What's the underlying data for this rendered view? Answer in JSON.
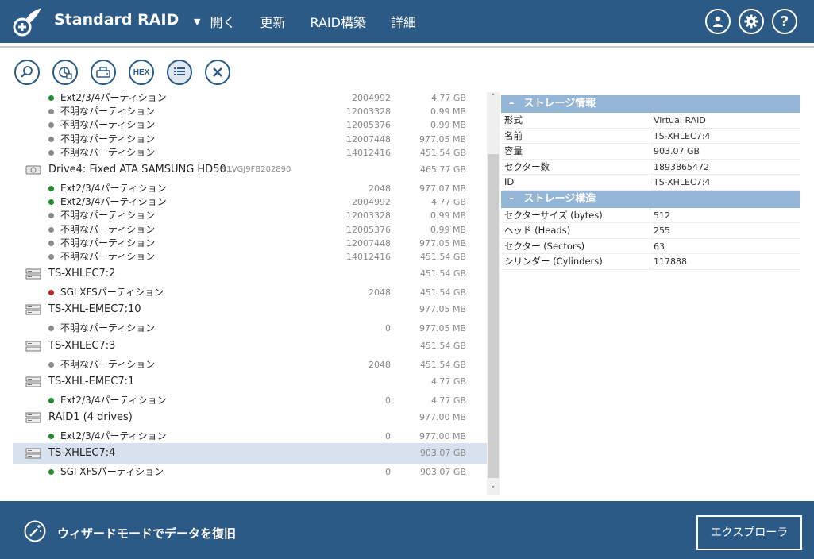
{
  "header": {
    "title": "Standard RAID",
    "menu_arrow": "▼",
    "menu": [
      "開く",
      "更新",
      "RAID構築",
      "詳細"
    ],
    "buttons": [
      {
        "name": "user-button",
        "icon": "user-icon"
      },
      {
        "name": "settings-button",
        "icon": "gear-icon"
      },
      {
        "name": "help-button",
        "icon": "help-icon",
        "glyph": "?"
      }
    ]
  },
  "toolbar": {
    "hex_label": "HEX",
    "icons": [
      "search-icon",
      "chart-icon",
      "drive-scan-icon",
      "hex-icon",
      "list-icon",
      "close-icon"
    ]
  },
  "tree": [
    {
      "kind": "part",
      "status": "green",
      "label": "Ext2/3/4パーティション",
      "offset": "2004992",
      "size": "4.77 GB"
    },
    {
      "kind": "part",
      "status": "gray",
      "label": "不明なパーティション",
      "offset": "12003328",
      "size": "0.99 MB"
    },
    {
      "kind": "part",
      "status": "gray",
      "label": "不明なパーティション",
      "offset": "12005376",
      "size": "0.99 MB"
    },
    {
      "kind": "part",
      "status": "gray",
      "label": "不明なパーティション",
      "offset": "12007448",
      "size": "977.05 MB"
    },
    {
      "kind": "part",
      "status": "gray",
      "label": "不明なパーティション",
      "offset": "14012416",
      "size": "451.54 GB"
    },
    {
      "kind": "dev",
      "icon": "hdd",
      "label": "Drive4: Fixed ATA SAMSUNG HD50...",
      "serial": "S1VGJ9FB202890",
      "size": "465.77 GB"
    },
    {
      "kind": "part",
      "status": "green",
      "label": "Ext2/3/4パーティション",
      "offset": "2048",
      "size": "977.07 MB"
    },
    {
      "kind": "part",
      "status": "green",
      "label": "Ext2/3/4パーティション",
      "offset": "2004992",
      "size": "4.77 GB"
    },
    {
      "kind": "part",
      "status": "gray",
      "label": "不明なパーティション",
      "offset": "12003328",
      "size": "0.99 MB"
    },
    {
      "kind": "part",
      "status": "gray",
      "label": "不明なパーティション",
      "offset": "12005376",
      "size": "0.99 MB"
    },
    {
      "kind": "part",
      "status": "gray",
      "label": "不明なパーティション",
      "offset": "12007448",
      "size": "977.05 MB"
    },
    {
      "kind": "part",
      "status": "gray",
      "label": "不明なパーティション",
      "offset": "14012416",
      "size": "451.54 GB"
    },
    {
      "kind": "dev",
      "icon": "raid",
      "label": "TS-XHLEC7:2",
      "size": "451.54 GB"
    },
    {
      "kind": "part",
      "status": "red",
      "label": "SGI XFSパーティション",
      "offset": "2048",
      "size": "451.54 GB"
    },
    {
      "kind": "dev",
      "icon": "raid",
      "label": "TS-XHL-EMEC7:10",
      "size": "977.05 MB"
    },
    {
      "kind": "part",
      "status": "gray",
      "label": "不明なパーティション",
      "offset": "0",
      "size": "977.05 MB"
    },
    {
      "kind": "dev",
      "icon": "raid",
      "label": "TS-XHLEC7:3",
      "size": "451.54 GB"
    },
    {
      "kind": "part",
      "status": "gray",
      "label": "不明なパーティション",
      "offset": "2048",
      "size": "451.54 GB"
    },
    {
      "kind": "dev",
      "icon": "raid",
      "label": "TS-XHL-EMEC7:1",
      "size": "4.77 GB"
    },
    {
      "kind": "part",
      "status": "green",
      "label": "Ext2/3/4パーティション",
      "offset": "0",
      "size": "4.77 GB"
    },
    {
      "kind": "dev",
      "icon": "raid",
      "label": "RAID1 (4 drives)",
      "size": "977.00 MB"
    },
    {
      "kind": "part",
      "status": "green",
      "label": "Ext2/3/4パーティション",
      "offset": "0",
      "size": "977.00 MB"
    },
    {
      "kind": "dev",
      "icon": "raid",
      "label": "TS-XHLEC7:4",
      "size": "903.07 GB",
      "selected": true
    },
    {
      "kind": "part",
      "status": "green",
      "label": "SGI XFSパーティション",
      "offset": "0",
      "size": "903.07 GB"
    }
  ],
  "scrollbar": {
    "up": "˄",
    "down": "˅"
  },
  "properties": {
    "storage_info": {
      "title": "ストレージ情報",
      "rows": [
        {
          "k": "形式",
          "v": "Virtual RAID"
        },
        {
          "k": "名前",
          "v": "TS-XHLEC7:4"
        },
        {
          "k": "容量",
          "v": "903.07 GB"
        },
        {
          "k": "セクター数",
          "v": "1893865472"
        },
        {
          "k": "ID",
          "v": "TS-XHLEC7:4"
        }
      ]
    },
    "storage_structure": {
      "title": "ストレージ構造",
      "rows": [
        {
          "k": "セクターサイズ (bytes)",
          "v": "512"
        },
        {
          "k": "ヘッド (Heads)",
          "v": "255"
        },
        {
          "k": "セクター (Sectors)",
          "v": "63"
        },
        {
          "k": "シリンダー (Cylinders)",
          "v": "117888"
        }
      ]
    },
    "dash": "–"
  },
  "footer": {
    "wizard_label": "ウィザードモードでデータを復旧",
    "explorer_label": "エクスプローラ"
  },
  "colors": {
    "accent": "#2c5a86",
    "section": "#94b6d6",
    "selected": "#d7e2ee"
  }
}
